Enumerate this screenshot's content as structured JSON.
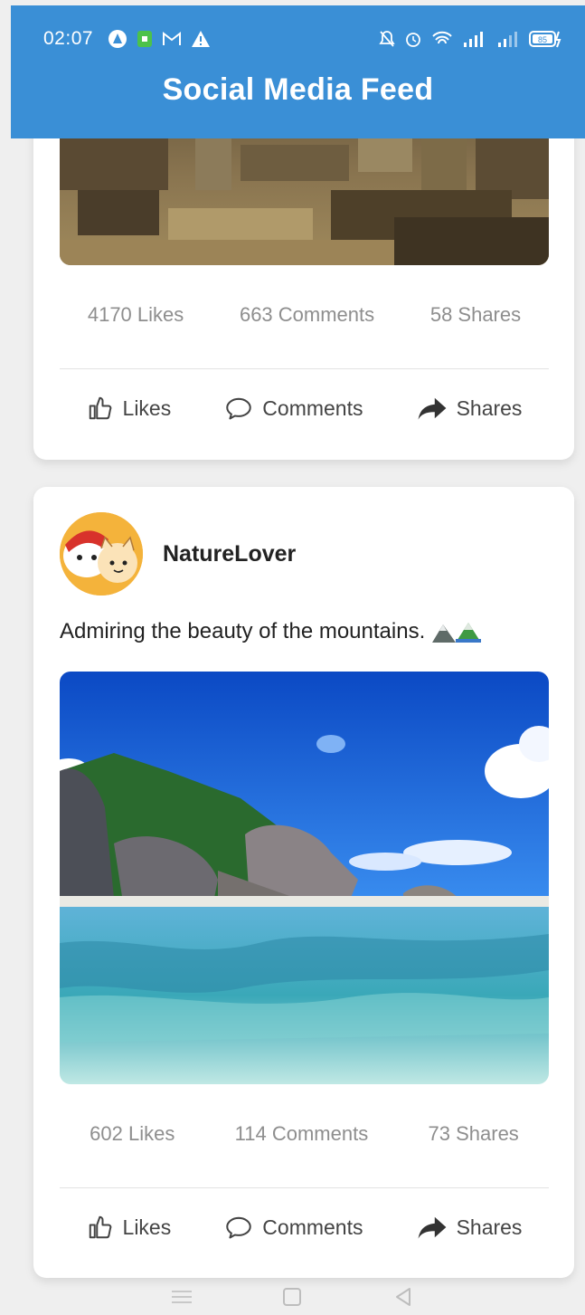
{
  "status_bar": {
    "time": "02:07",
    "left_icons": [
      "app-notification-icon",
      "store-icon",
      "mail-icon",
      "warning-icon"
    ],
    "right_icons": [
      "mute-icon",
      "alarm-icon",
      "wifi-icon",
      "signal-icon",
      "signal-icon",
      "battery-icon"
    ],
    "battery": "85"
  },
  "header": {
    "title": "Social Media Feed"
  },
  "posts": [
    {
      "image": "ancient-ruins-photo",
      "stats": {
        "likes": "4170 Likes",
        "comments": "663 Comments",
        "shares": "58 Shares"
      },
      "actions": {
        "like": "Likes",
        "comment": "Comments",
        "share": "Shares"
      }
    },
    {
      "author": "NatureLover",
      "text": "Admiring the beauty of the mountains.",
      "image": "tropical-beach-photo",
      "stats": {
        "likes": "602 Likes",
        "comments": "114 Comments",
        "shares": "73 Shares"
      },
      "actions": {
        "like": "Likes",
        "comment": "Comments",
        "share": "Shares"
      }
    }
  ],
  "nav": {
    "items": [
      "menu-icon",
      "home-icon",
      "back-icon"
    ]
  },
  "colors": {
    "header": "#3a8fd6",
    "background": "#efefef",
    "card": "#ffffff",
    "stat_text": "#8e8e8e"
  }
}
